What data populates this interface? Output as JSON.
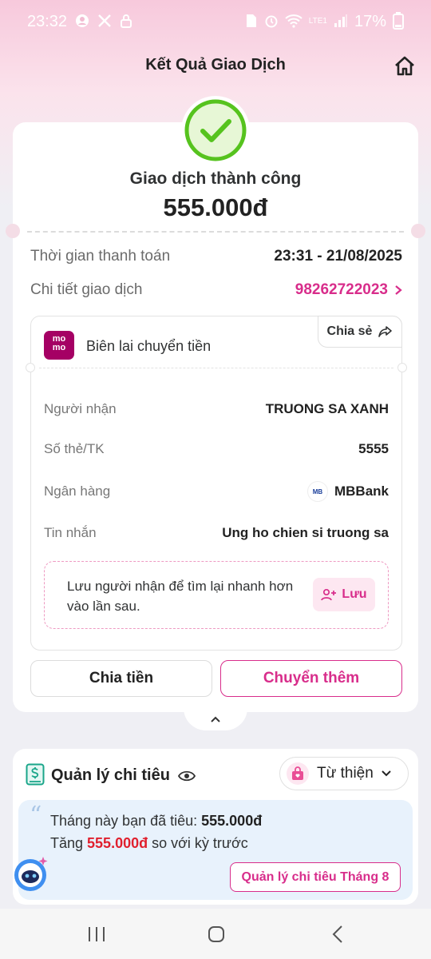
{
  "status_bar": {
    "time": "23:32",
    "left_icons": [
      "account-icon",
      "x-icon",
      "lock-icon"
    ],
    "right_icons": [
      "sim-icon",
      "alarm-icon",
      "wifi-icon"
    ],
    "network": "LTE1",
    "battery": "17%"
  },
  "header": {
    "title": "Kết Quả Giao Dịch",
    "home_icon": "home-icon"
  },
  "result": {
    "status": "Giao dịch thành công",
    "amount": "555.000đ",
    "time_label": "Thời gian thanh toán",
    "time_value": "23:31 - 21/08/2025",
    "detail_label": "Chi tiết giao dịch",
    "detail_value": "98262722023"
  },
  "receipt": {
    "logo_text_1": "mo",
    "logo_text_2": "mo",
    "title": "Biên lai chuyển tiền",
    "share_label": "Chia sẻ",
    "rows": [
      {
        "label": "Người nhận",
        "value": "TRUONG SA XANH"
      },
      {
        "label": "Số thẻ/TK",
        "value": "5555"
      },
      {
        "label": "Ngân hàng",
        "value": "MBBank"
      },
      {
        "label": "Tin nhắn",
        "value": "Ung ho chien si truong sa"
      }
    ],
    "bank_logo_text": "MB",
    "save_hint": "Lưu người nhận để tìm lại nhanh hơn vào lần sau.",
    "save_label": "Lưu"
  },
  "actions": {
    "split_label": "Chia tiền",
    "transfer_more_label": "Chuyển thêm"
  },
  "spending": {
    "title": "Quản lý chi tiêu",
    "category_label": "Từ thiện",
    "line1_prefix": "Tháng này bạn đã tiêu: ",
    "line1_amount": "555.000đ",
    "line2_prefix": "Tăng ",
    "line2_amount": "555.000đ",
    "line2_suffix": " so với kỳ trước",
    "month_button": "Quản lý chi tiêu Tháng 8"
  },
  "colors": {
    "brand": "#d82d8b",
    "success": "#56c31e",
    "increase": "#e0202e"
  }
}
